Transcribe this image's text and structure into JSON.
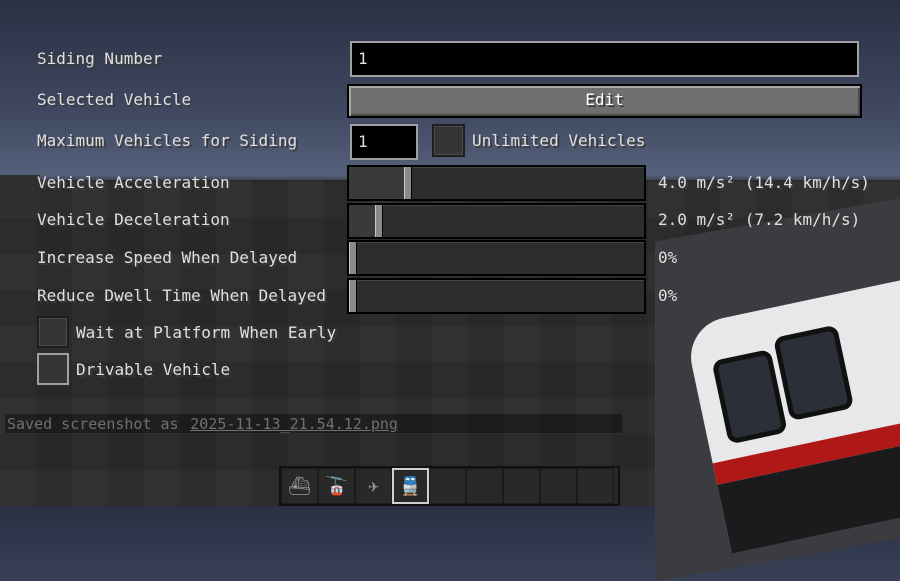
{
  "form": {
    "siding_number": {
      "label": "Siding Number",
      "value": "1"
    },
    "selected_vehicle": {
      "label": "Selected Vehicle",
      "button": "Edit"
    },
    "max_vehicles": {
      "label": "Maximum Vehicles for Siding",
      "value": "1",
      "unlimited_label": "Unlimited Vehicles",
      "unlimited_checked": false
    },
    "acceleration": {
      "label": "Vehicle Acceleration",
      "value_text": "4.0 m/s² (14.4 km/h/s)",
      "level": 0.19
    },
    "deceleration": {
      "label": "Vehicle Deceleration",
      "value_text": "2.0 m/s² (7.2 km/h/s)",
      "level": 0.09
    },
    "increase_speed": {
      "label": "Increase Speed When Delayed",
      "value_text": "0%",
      "level": 0.0
    },
    "reduce_dwell": {
      "label": "Reduce Dwell Time When Delayed",
      "value_text": "0%",
      "level": 0.0
    },
    "wait_platform": {
      "label": "Wait at Platform When Early",
      "checked": false
    },
    "drivable": {
      "label": "Drivable Vehicle",
      "checked": false
    }
  },
  "chat": {
    "prefix": "Saved screenshot as",
    "filename": "2025-11-13_21.54.12.png"
  },
  "hotbar": {
    "slots": [
      "boat-icon",
      "cable-car-icon",
      "airplane-icon",
      "train-icon",
      "",
      "",
      "",
      "",
      ""
    ],
    "glyphs": [
      "⛴",
      "🚡",
      "✈",
      "🚆",
      "",
      "",
      "",
      "",
      ""
    ],
    "selected": 3
  },
  "colors": {
    "text": "#e0e0e0",
    "button": "#6f6f6f",
    "field_bg": "#000000",
    "sky": "#3f4860",
    "train_stripe": "#b01818"
  }
}
